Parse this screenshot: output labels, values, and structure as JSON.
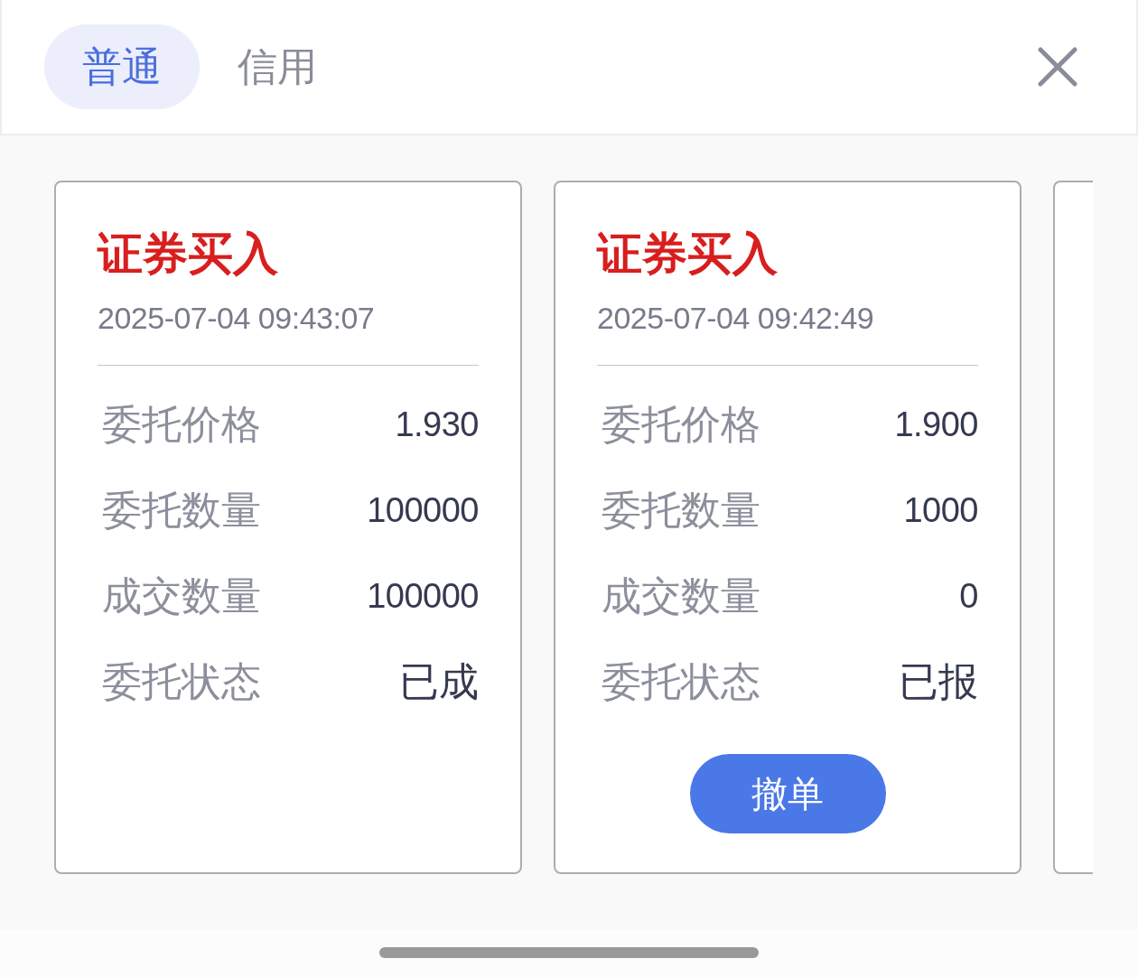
{
  "tabs": [
    {
      "label": "普通",
      "selected": true
    },
    {
      "label": "信用",
      "selected": false
    }
  ],
  "orders": [
    {
      "title": "证券买入",
      "time": "2025-07-04 09:43:07",
      "fields": [
        {
          "label": "委托价格",
          "value": "1.930"
        },
        {
          "label": "委托数量",
          "value": "100000"
        },
        {
          "label": "成交数量",
          "value": "100000"
        },
        {
          "label": "委托状态",
          "value": "已成"
        }
      ]
    },
    {
      "title": "证券买入",
      "time": "2025-07-04 09:42:49",
      "fields": [
        {
          "label": "委托价格",
          "value": "1.900"
        },
        {
          "label": "委托数量",
          "value": "1000"
        },
        {
          "label": "成交数量",
          "value": "0"
        },
        {
          "label": "委托状态",
          "value": "已报"
        }
      ],
      "action": "撤单"
    }
  ]
}
